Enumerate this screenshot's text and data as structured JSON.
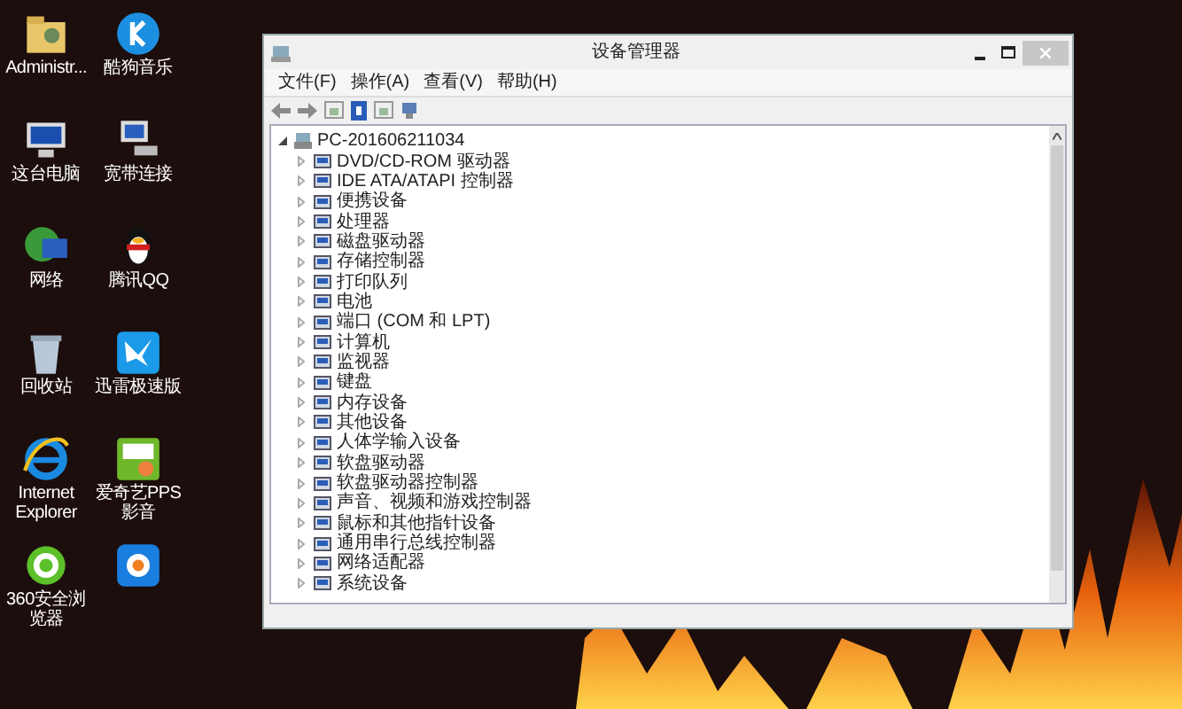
{
  "desktop_icons": [
    {
      "label": "Administr...",
      "kind": "folder"
    },
    {
      "label": "酷狗音乐",
      "kind": "music"
    },
    {
      "label": "这台电脑",
      "kind": "computer"
    },
    {
      "label": "宽带连接",
      "kind": "network"
    },
    {
      "label": "网络",
      "kind": "globe"
    },
    {
      "label": "腾讯QQ",
      "kind": "penguin"
    },
    {
      "label": "回收站",
      "kind": "bin"
    },
    {
      "label": "迅雷极速版",
      "kind": "bird"
    },
    {
      "label": "Internet Explorer",
      "kind": "ie"
    },
    {
      "label": "爱奇艺PPS 影音",
      "kind": "video"
    },
    {
      "label": "360安全浏览器",
      "kind": "ie360"
    },
    {
      "kind": "pptv"
    }
  ],
  "window": {
    "title": "设备管理器",
    "menu": [
      "文件(F)",
      "操作(A)",
      "查看(V)",
      "帮助(H)"
    ],
    "tree": {
      "label": "PC-201606211034",
      "expanded": true,
      "children": [
        {
          "label": "DVD/CD-ROM 驱动器",
          "expanded": false
        },
        {
          "label": "IDE ATA/ATAPI 控制器",
          "expanded": false
        },
        {
          "label": "便携设备",
          "expanded": false
        },
        {
          "label": "处理器",
          "expanded": false
        },
        {
          "label": "磁盘驱动器",
          "expanded": false
        },
        {
          "label": "存储控制器",
          "expanded": false
        },
        {
          "label": "打印队列",
          "expanded": false
        },
        {
          "label": "电池",
          "expanded": false
        },
        {
          "label": "端口 (COM 和 LPT)",
          "expanded": false
        },
        {
          "label": "计算机",
          "expanded": false
        },
        {
          "label": "监视器",
          "expanded": false
        },
        {
          "label": "键盘",
          "expanded": false
        },
        {
          "label": "内存设备",
          "expanded": false
        },
        {
          "label": "其他设备",
          "expanded": false
        },
        {
          "label": "人体学输入设备",
          "expanded": false
        },
        {
          "label": "软盘驱动器",
          "expanded": false
        },
        {
          "label": "软盘驱动器控制器",
          "expanded": false
        },
        {
          "label": "声音、视频和游戏控制器",
          "expanded": false
        },
        {
          "label": "鼠标和其他指针设备",
          "expanded": false
        },
        {
          "label": "通用串行总线控制器",
          "expanded": false
        },
        {
          "label": "网络适配器",
          "expanded": false
        },
        {
          "label": "系统设备",
          "expanded": false
        }
      ]
    }
  }
}
